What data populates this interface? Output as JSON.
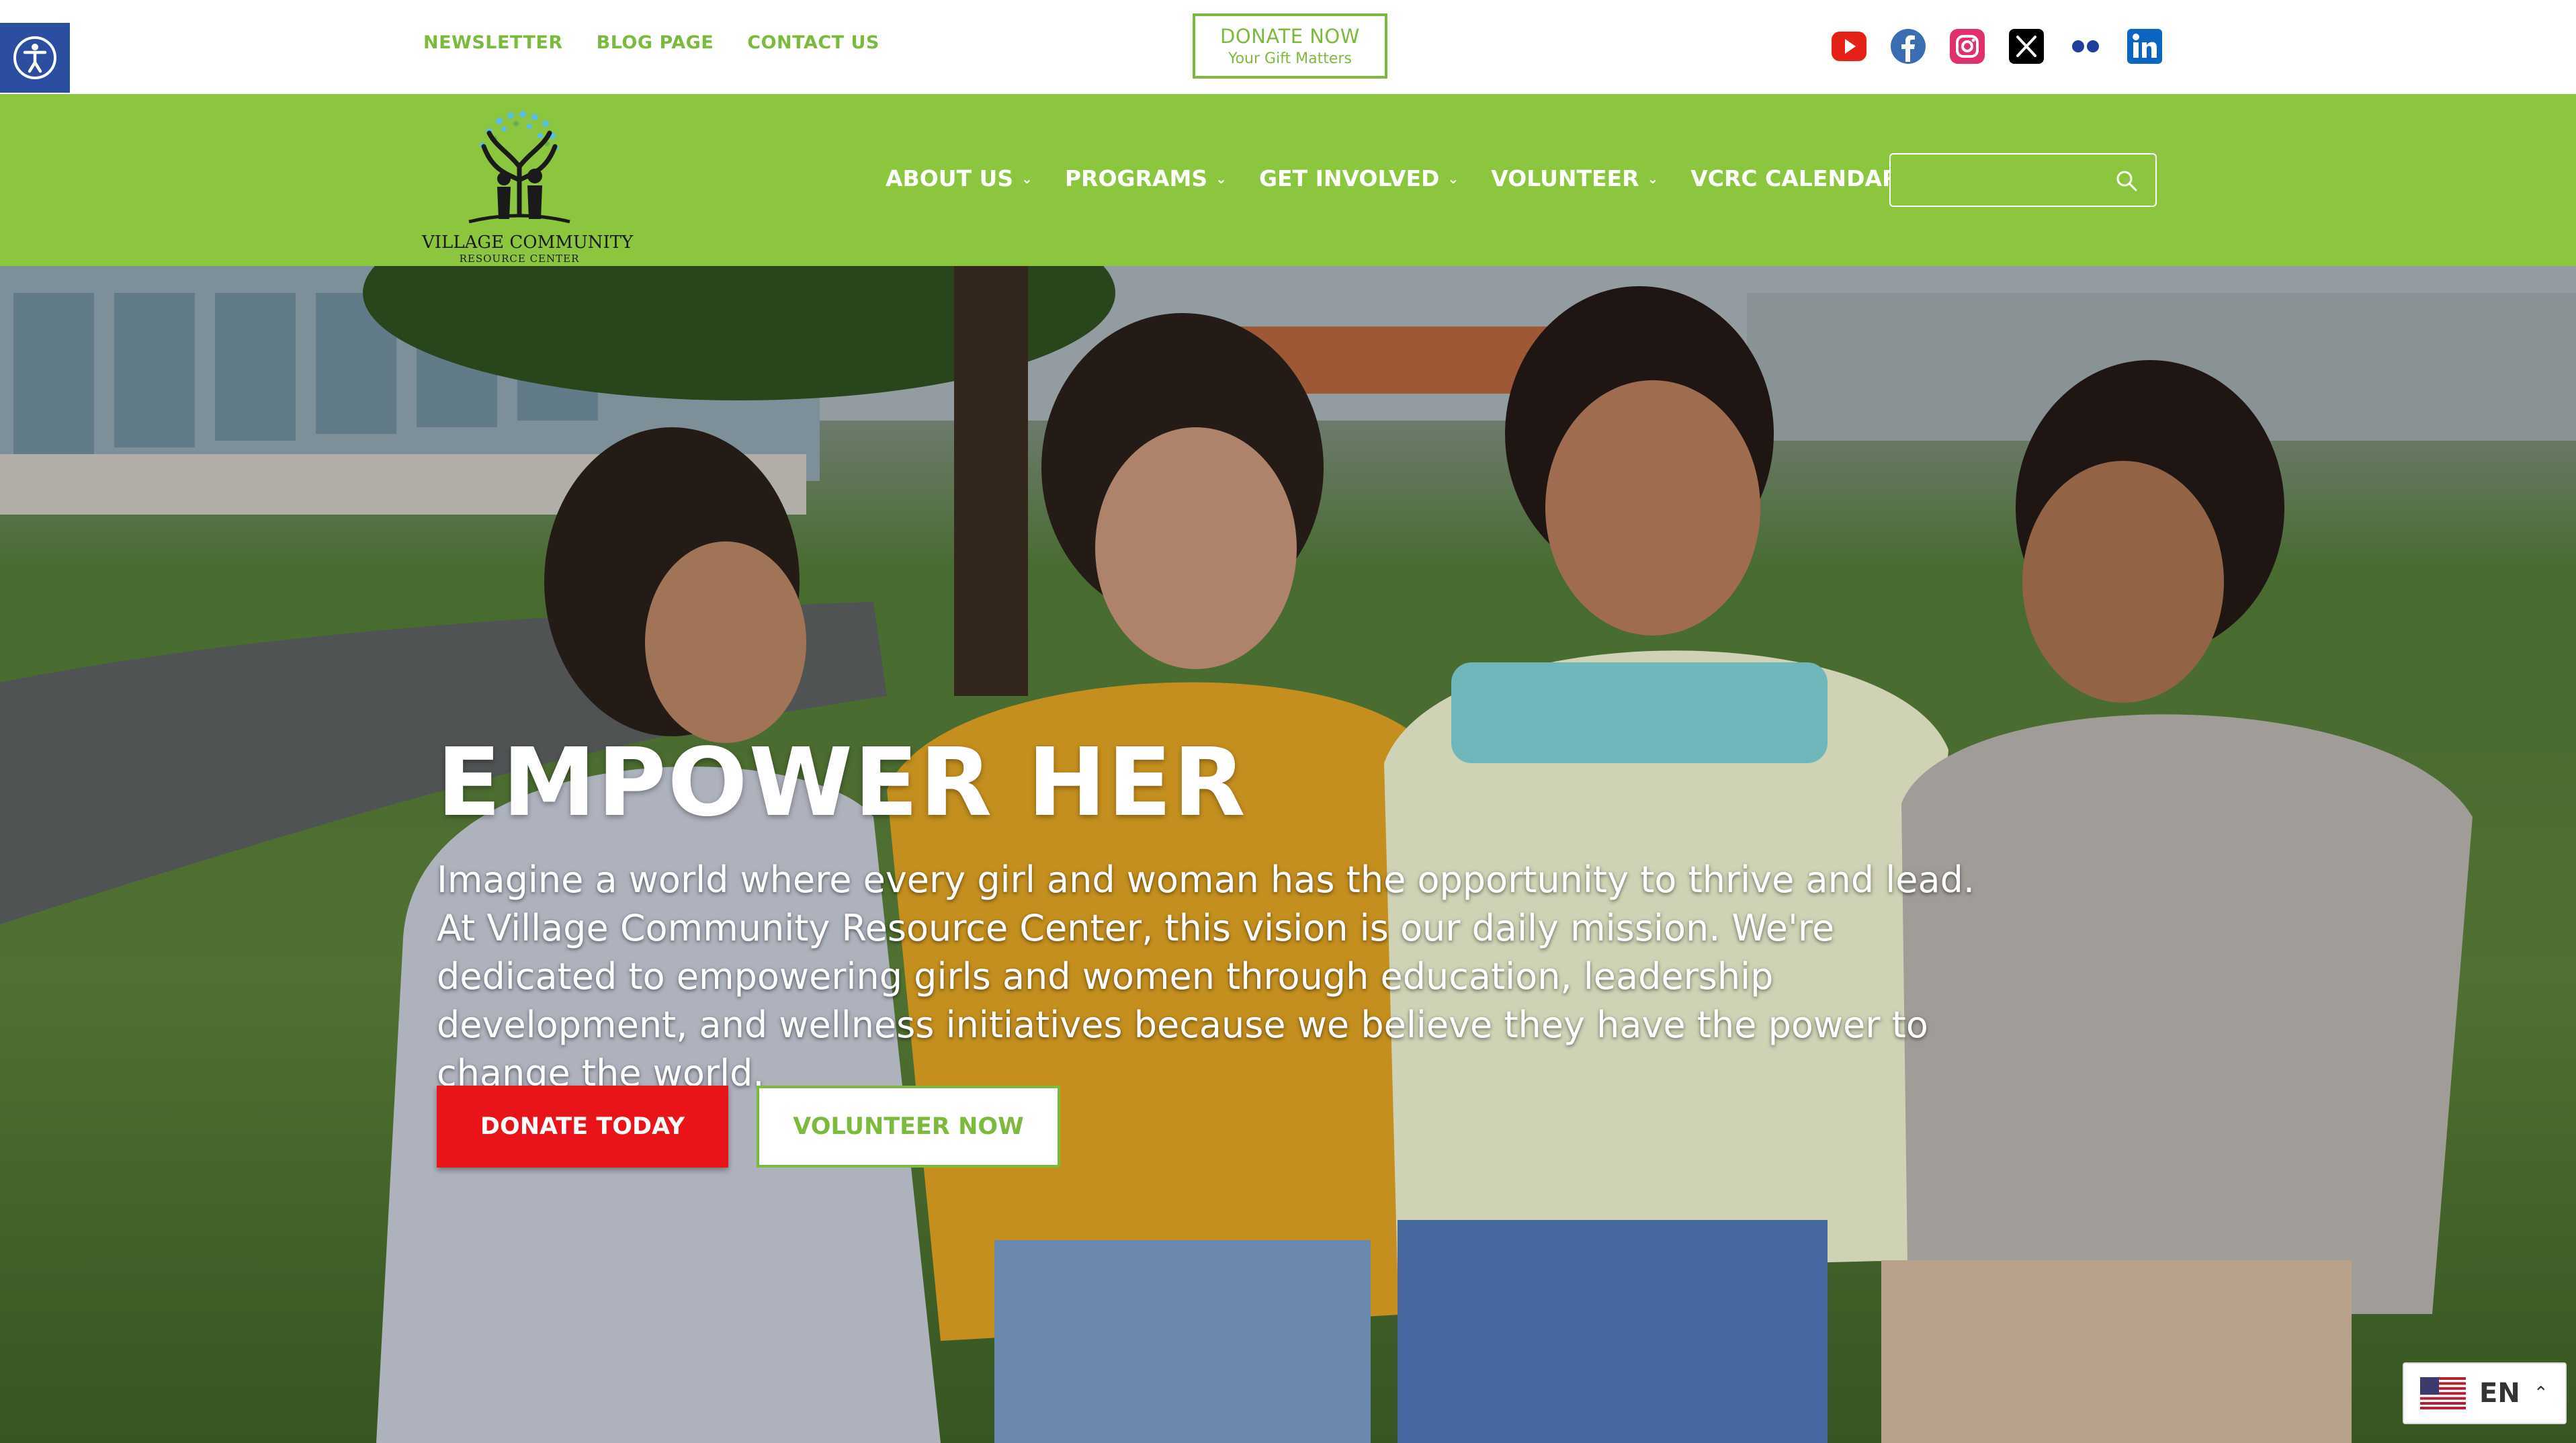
{
  "top_links": [
    "NEWSLETTER",
    "BLOG PAGE",
    "CONTACT US"
  ],
  "donate_now": {
    "title": "DONATE NOW",
    "subtitle": "Your Gift Matters"
  },
  "socials": [
    "youtube-icon",
    "facebook-icon",
    "instagram-icon",
    "x-icon",
    "flickr-icon",
    "linkedin-icon"
  ],
  "logo": {
    "line1": "VILLAGE COMMUNITY",
    "line2": "RESOURCE CENTER"
  },
  "menu": [
    {
      "label": "ABOUT US",
      "has_dropdown": true
    },
    {
      "label": "PROGRAMS",
      "has_dropdown": true
    },
    {
      "label": "GET INVOLVED",
      "has_dropdown": true
    },
    {
      "label": "VOLUNTEER",
      "has_dropdown": true
    },
    {
      "label": "VCRC CALENDAR",
      "has_dropdown": false
    }
  ],
  "search": {
    "value": "",
    "placeholder": ""
  },
  "hero": {
    "title": "EMPOWER HER",
    "text": "Imagine a world where every girl and woman has the opportunity to thrive and lead. At Village Community Resource Center, this vision is our daily mission. We're dedicated to empowering girls and women through education, leadership development, and wellness initiatives because we believe they have the power to change the world.",
    "donate_label": "DONATE TODAY",
    "volunteer_label": "VOLUNTEER NOW"
  },
  "language": {
    "code": "EN"
  },
  "colors": {
    "brand_green": "#8cc63f",
    "link_green": "#7cba3e",
    "donate_red": "#e8141a",
    "a11y_blue": "#2b4ea1"
  }
}
